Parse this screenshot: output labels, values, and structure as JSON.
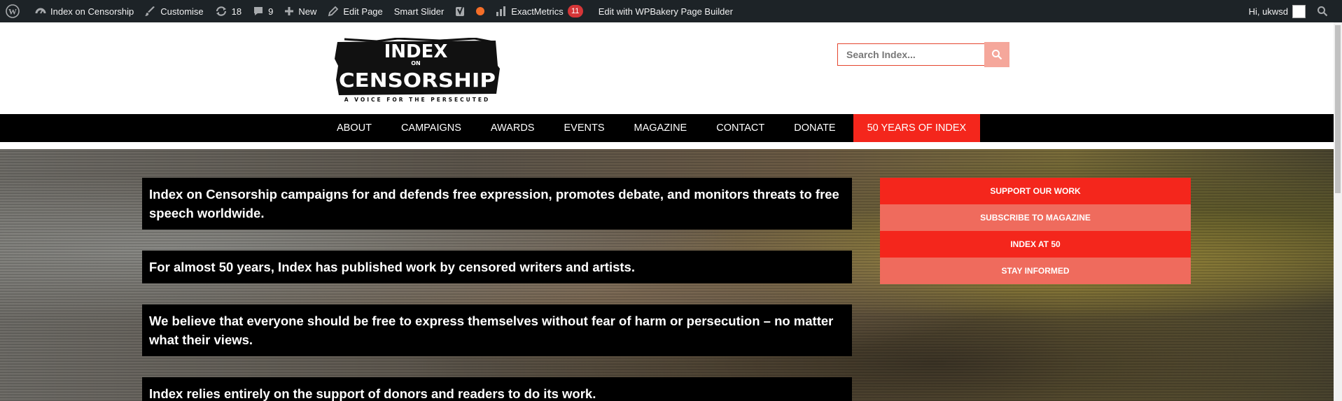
{
  "admin_bar": {
    "site_name": "Index on Censorship",
    "customise": "Customise",
    "updates_count": "18",
    "comments_count": "9",
    "new": "New",
    "edit_page": "Edit Page",
    "smart_slider": "Smart Slider",
    "exactmetrics": "ExactMetrics",
    "exactmetrics_badge": "11",
    "wpbakery": "Edit with WPBakery Page Builder",
    "greeting": "Hi, ukwsd"
  },
  "header": {
    "logo_line1": "INDEX",
    "logo_line2": "ON",
    "logo_line3": "CENSORSHIP",
    "logo_tagline": "A VOICE FOR THE PERSECUTED",
    "search_placeholder": "Search Index..."
  },
  "nav": {
    "items": [
      "ABOUT",
      "CAMPAIGNS",
      "AWARDS",
      "EVENTS",
      "MAGAZINE",
      "CONTACT",
      "DONATE",
      "50 YEARS OF INDEX"
    ]
  },
  "hero": {
    "messages": [
      "Index on Censorship campaigns for and defends free expression, promotes debate, and monitors threats to free speech worldwide.",
      "For almost 50 years, Index has published work by censored writers and artists.",
      "We believe that everyone should be free to express themselves without fear of harm or persecution – no matter what their views.",
      "Index relies entirely on the support of donors and readers to do its work."
    ],
    "ctas": [
      "SUPPORT OUR WORK",
      "SUBSCRIBE TO MAGAZINE",
      "INDEX AT 50",
      "STAY INFORMED"
    ]
  },
  "colors": {
    "accent_red": "#f4261c",
    "accent_light_red": "#ef6b5d",
    "admin_bar": "#1d2327"
  }
}
